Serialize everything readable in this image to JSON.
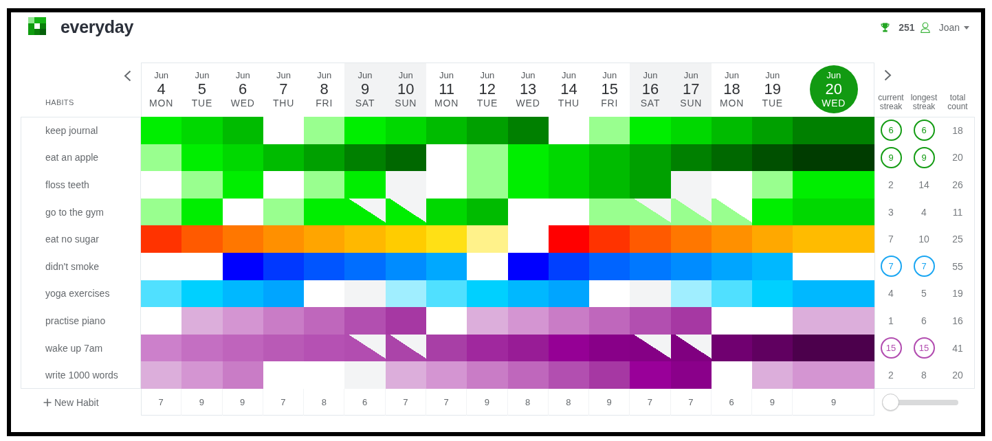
{
  "header": {
    "app_name": "everyday",
    "points": "251",
    "user_name": "Joan"
  },
  "table": {
    "habits_heading": "HABITS",
    "days": [
      {
        "month": "Jun",
        "day": "4",
        "weekday": "MON",
        "weekend": false,
        "selected": false
      },
      {
        "month": "Jun",
        "day": "5",
        "weekday": "TUE",
        "weekend": false,
        "selected": false
      },
      {
        "month": "Jun",
        "day": "6",
        "weekday": "WED",
        "weekend": false,
        "selected": false
      },
      {
        "month": "Jun",
        "day": "7",
        "weekday": "THU",
        "weekend": false,
        "selected": false
      },
      {
        "month": "Jun",
        "day": "8",
        "weekday": "FRI",
        "weekend": false,
        "selected": false
      },
      {
        "month": "Jun",
        "day": "9",
        "weekday": "SAT",
        "weekend": true,
        "selected": false
      },
      {
        "month": "Jun",
        "day": "10",
        "weekday": "SUN",
        "weekend": true,
        "selected": false
      },
      {
        "month": "Jun",
        "day": "11",
        "weekday": "MON",
        "weekend": false,
        "selected": false
      },
      {
        "month": "Jun",
        "day": "12",
        "weekday": "TUE",
        "weekend": false,
        "selected": false
      },
      {
        "month": "Jun",
        "day": "13",
        "weekday": "WED",
        "weekend": false,
        "selected": false
      },
      {
        "month": "Jun",
        "day": "14",
        "weekday": "THU",
        "weekend": false,
        "selected": false
      },
      {
        "month": "Jun",
        "day": "15",
        "weekday": "FRI",
        "weekend": false,
        "selected": false
      },
      {
        "month": "Jun",
        "day": "16",
        "weekday": "SAT",
        "weekend": true,
        "selected": false
      },
      {
        "month": "Jun",
        "day": "17",
        "weekday": "SUN",
        "weekend": true,
        "selected": false
      },
      {
        "month": "Jun",
        "day": "18",
        "weekday": "MON",
        "weekend": false,
        "selected": false
      },
      {
        "month": "Jun",
        "day": "19",
        "weekday": "TUE",
        "weekend": false,
        "selected": false
      },
      {
        "month": "Jun",
        "day": "20",
        "weekday": "WED",
        "weekend": false,
        "selected": true
      }
    ],
    "stat_headings": [
      "current streak",
      "longest streak",
      "total count"
    ],
    "habits": [
      {
        "name": "keep journal",
        "cells": [
          {
            "kind": "full",
            "color": "#00ee00"
          },
          {
            "kind": "full",
            "color": "#00d800"
          },
          {
            "kind": "full",
            "color": "#00bb00"
          },
          {
            "kind": "empty"
          },
          {
            "kind": "full",
            "color": "#99ff8f"
          },
          {
            "kind": "full",
            "color": "#00ee00"
          },
          {
            "kind": "full",
            "color": "#00d800"
          },
          {
            "kind": "full",
            "color": "#00bb00"
          },
          {
            "kind": "full",
            "color": "#00a000"
          },
          {
            "kind": "full",
            "color": "#008000"
          },
          {
            "kind": "empty"
          },
          {
            "kind": "full",
            "color": "#99ff8f"
          },
          {
            "kind": "full",
            "color": "#00ee00"
          },
          {
            "kind": "full",
            "color": "#00d800"
          },
          {
            "kind": "full",
            "color": "#00bb00"
          },
          {
            "kind": "full",
            "color": "#00a000"
          },
          {
            "kind": "full",
            "color": "#008000"
          }
        ],
        "current_streak": {
          "value": "6",
          "highlighted": true,
          "color": "#149c14"
        },
        "longest_streak": {
          "value": "6",
          "highlighted": true,
          "color": "#149c14"
        },
        "total": "18"
      },
      {
        "name": "eat an apple",
        "cells": [
          {
            "kind": "full",
            "color": "#99ff8f"
          },
          {
            "kind": "full",
            "color": "#00ee00"
          },
          {
            "kind": "full",
            "color": "#00d800"
          },
          {
            "kind": "full",
            "color": "#00bb00"
          },
          {
            "kind": "full",
            "color": "#00a000"
          },
          {
            "kind": "full",
            "color": "#008000"
          },
          {
            "kind": "full",
            "color": "#006800"
          },
          {
            "kind": "empty"
          },
          {
            "kind": "full",
            "color": "#99ff8f"
          },
          {
            "kind": "full",
            "color": "#00ee00"
          },
          {
            "kind": "full",
            "color": "#00d800"
          },
          {
            "kind": "full",
            "color": "#00bb00"
          },
          {
            "kind": "full",
            "color": "#00a000"
          },
          {
            "kind": "full",
            "color": "#008000"
          },
          {
            "kind": "full",
            "color": "#006800"
          },
          {
            "kind": "full",
            "color": "#005000"
          },
          {
            "kind": "full",
            "color": "#003c00"
          }
        ],
        "current_streak": {
          "value": "9",
          "highlighted": true,
          "color": "#149c14"
        },
        "longest_streak": {
          "value": "9",
          "highlighted": true,
          "color": "#149c14"
        },
        "total": "20"
      },
      {
        "name": "floss teeth",
        "cells": [
          {
            "kind": "empty"
          },
          {
            "kind": "full",
            "color": "#99ff8f"
          },
          {
            "kind": "full",
            "color": "#00ee00"
          },
          {
            "kind": "empty"
          },
          {
            "kind": "full",
            "color": "#99ff8f"
          },
          {
            "kind": "full",
            "color": "#00ee00"
          },
          {
            "kind": "empty"
          },
          {
            "kind": "empty"
          },
          {
            "kind": "full",
            "color": "#99ff8f"
          },
          {
            "kind": "full",
            "color": "#00ee00"
          },
          {
            "kind": "full",
            "color": "#00d800"
          },
          {
            "kind": "full",
            "color": "#00bb00"
          },
          {
            "kind": "full",
            "color": "#00a000"
          },
          {
            "kind": "empty"
          },
          {
            "kind": "empty"
          },
          {
            "kind": "full",
            "color": "#99ff8f"
          },
          {
            "kind": "full",
            "color": "#00ee00"
          }
        ],
        "current_streak": {
          "value": "2",
          "highlighted": false
        },
        "longest_streak": {
          "value": "14",
          "highlighted": false
        },
        "total": "26"
      },
      {
        "name": "go to the gym",
        "cells": [
          {
            "kind": "full",
            "color": "#99ff8f"
          },
          {
            "kind": "full",
            "color": "#00ee00"
          },
          {
            "kind": "empty"
          },
          {
            "kind": "full",
            "color": "#99ff8f"
          },
          {
            "kind": "full",
            "color": "#00ee00"
          },
          {
            "kind": "half",
            "color": "#00ee00"
          },
          {
            "kind": "half",
            "color": "#00ee00"
          },
          {
            "kind": "full",
            "color": "#00d800"
          },
          {
            "kind": "full",
            "color": "#00bb00"
          },
          {
            "kind": "empty"
          },
          {
            "kind": "empty"
          },
          {
            "kind": "full",
            "color": "#99ff8f"
          },
          {
            "kind": "half",
            "color": "#99ff8f"
          },
          {
            "kind": "half",
            "color": "#99ff8f"
          },
          {
            "kind": "half",
            "color": "#99ff8f"
          },
          {
            "kind": "full",
            "color": "#00ee00"
          },
          {
            "kind": "full",
            "color": "#00d800"
          }
        ],
        "current_streak": {
          "value": "3",
          "highlighted": false
        },
        "longest_streak": {
          "value": "4",
          "highlighted": false
        },
        "total": "11"
      },
      {
        "name": "eat no sugar",
        "cells": [
          {
            "kind": "full",
            "color": "#ff3300"
          },
          {
            "kind": "full",
            "color": "#ff5a00"
          },
          {
            "kind": "full",
            "color": "#ff7700"
          },
          {
            "kind": "full",
            "color": "#ff9000"
          },
          {
            "kind": "full",
            "color": "#ffa500"
          },
          {
            "kind": "full",
            "color": "#ffb800"
          },
          {
            "kind": "full",
            "color": "#ffcc00"
          },
          {
            "kind": "full",
            "color": "#ffe015"
          },
          {
            "kind": "full",
            "color": "#fff28a"
          },
          {
            "kind": "empty"
          },
          {
            "kind": "full",
            "color": "#ff0000"
          },
          {
            "kind": "full",
            "color": "#ff3300"
          },
          {
            "kind": "full",
            "color": "#ff5a00"
          },
          {
            "kind": "full",
            "color": "#ff7700"
          },
          {
            "kind": "full",
            "color": "#ff9000"
          },
          {
            "kind": "full",
            "color": "#ffa800"
          },
          {
            "kind": "full",
            "color": "#ffbb00"
          }
        ],
        "current_streak": {
          "value": "7",
          "highlighted": false
        },
        "longest_streak": {
          "value": "10",
          "highlighted": false
        },
        "total": "25"
      },
      {
        "name": "didn't smoke",
        "cells": [
          {
            "kind": "empty"
          },
          {
            "kind": "empty"
          },
          {
            "kind": "full",
            "color": "#0000ff"
          },
          {
            "kind": "full",
            "color": "#0038ff"
          },
          {
            "kind": "full",
            "color": "#0055ff"
          },
          {
            "kind": "full",
            "color": "#006eff"
          },
          {
            "kind": "full",
            "color": "#008cff"
          },
          {
            "kind": "full",
            "color": "#00a8ff"
          },
          {
            "kind": "empty"
          },
          {
            "kind": "full",
            "color": "#0000ff"
          },
          {
            "kind": "full",
            "color": "#0040ff"
          },
          {
            "kind": "full",
            "color": "#0064ff"
          },
          {
            "kind": "full",
            "color": "#0078ff"
          },
          {
            "kind": "full",
            "color": "#008cff"
          },
          {
            "kind": "full",
            "color": "#00a5ff"
          },
          {
            "kind": "full",
            "color": "#00b8ff"
          },
          {
            "kind": "empty"
          }
        ],
        "current_streak": {
          "value": "7",
          "highlighted": true,
          "color": "#1aa6f2"
        },
        "longest_streak": {
          "value": "7",
          "highlighted": true,
          "color": "#1aa6f2"
        },
        "total": "55"
      },
      {
        "name": "yoga exercises",
        "cells": [
          {
            "kind": "full",
            "color": "#50e0ff"
          },
          {
            "kind": "full",
            "color": "#00d0ff"
          },
          {
            "kind": "full",
            "color": "#00b8ff"
          },
          {
            "kind": "full",
            "color": "#00a5ff"
          },
          {
            "kind": "empty"
          },
          {
            "kind": "empty"
          },
          {
            "kind": "full",
            "color": "#a0eeff"
          },
          {
            "kind": "full",
            "color": "#50e0ff"
          },
          {
            "kind": "full",
            "color": "#00d0ff"
          },
          {
            "kind": "full",
            "color": "#00b8ff"
          },
          {
            "kind": "full",
            "color": "#00a5ff"
          },
          {
            "kind": "empty"
          },
          {
            "kind": "empty"
          },
          {
            "kind": "full",
            "color": "#a0eeff"
          },
          {
            "kind": "full",
            "color": "#50e0ff"
          },
          {
            "kind": "full",
            "color": "#00d0ff"
          },
          {
            "kind": "full",
            "color": "#00b8ff"
          }
        ],
        "current_streak": {
          "value": "4",
          "highlighted": false
        },
        "longest_streak": {
          "value": "5",
          "highlighted": false
        },
        "total": "19"
      },
      {
        "name": "practise piano",
        "cells": [
          {
            "kind": "empty"
          },
          {
            "kind": "full",
            "color": "#dcaedb"
          },
          {
            "kind": "full",
            "color": "#d495d2"
          },
          {
            "kind": "full",
            "color": "#c97cc6"
          },
          {
            "kind": "full",
            "color": "#bf67bc"
          },
          {
            "kind": "full",
            "color": "#b24fb0"
          },
          {
            "kind": "full",
            "color": "#a638a3"
          },
          {
            "kind": "empty"
          },
          {
            "kind": "full",
            "color": "#dcaedb"
          },
          {
            "kind": "full",
            "color": "#d495d2"
          },
          {
            "kind": "full",
            "color": "#c97cc6"
          },
          {
            "kind": "full",
            "color": "#bf67bc"
          },
          {
            "kind": "full",
            "color": "#b24fb0"
          },
          {
            "kind": "full",
            "color": "#a638a3"
          },
          {
            "kind": "empty"
          },
          {
            "kind": "empty"
          },
          {
            "kind": "full",
            "color": "#dcaedb"
          }
        ],
        "current_streak": {
          "value": "1",
          "highlighted": false
        },
        "longest_streak": {
          "value": "6",
          "highlighted": false
        },
        "total": "16"
      },
      {
        "name": "wake up 7am",
        "cells": [
          {
            "kind": "full",
            "color": "#cc80cb"
          },
          {
            "kind": "full",
            "color": "#c46fc2"
          },
          {
            "kind": "full",
            "color": "#bf64bc"
          },
          {
            "kind": "full",
            "color": "#b95ab6"
          },
          {
            "kind": "full",
            "color": "#b551b3"
          },
          {
            "kind": "half",
            "color": "#b24db0"
          },
          {
            "kind": "half",
            "color": "#ab44a9"
          },
          {
            "kind": "full",
            "color": "#a83fa6"
          },
          {
            "kind": "full",
            "color": "#a0289e"
          },
          {
            "kind": "full",
            "color": "#981c96"
          },
          {
            "kind": "full",
            "color": "#950095"
          },
          {
            "kind": "full",
            "color": "#880088"
          },
          {
            "kind": "half",
            "color": "#850085"
          },
          {
            "kind": "half",
            "color": "#800080"
          },
          {
            "kind": "full",
            "color": "#700070"
          },
          {
            "kind": "full",
            "color": "#600060"
          },
          {
            "kind": "full",
            "color": "#4c004c"
          }
        ],
        "current_streak": {
          "value": "15",
          "highlighted": true,
          "color": "#b24db0"
        },
        "longest_streak": {
          "value": "15",
          "highlighted": true,
          "color": "#b24db0"
        },
        "total": "41"
      },
      {
        "name": "write 1000 words",
        "cells": [
          {
            "kind": "full",
            "color": "#dcaedb"
          },
          {
            "kind": "full",
            "color": "#d495d2"
          },
          {
            "kind": "full",
            "color": "#c97cc6"
          },
          {
            "kind": "empty"
          },
          {
            "kind": "empty"
          },
          {
            "kind": "empty"
          },
          {
            "kind": "full",
            "color": "#dcaedb"
          },
          {
            "kind": "full",
            "color": "#d495d2"
          },
          {
            "kind": "full",
            "color": "#c97cc6"
          },
          {
            "kind": "full",
            "color": "#bf67bc"
          },
          {
            "kind": "full",
            "color": "#b24fb0"
          },
          {
            "kind": "full",
            "color": "#a638a3"
          },
          {
            "kind": "full",
            "color": "#990099"
          },
          {
            "kind": "full",
            "color": "#8a008a"
          },
          {
            "kind": "empty"
          },
          {
            "kind": "full",
            "color": "#dcaedb"
          },
          {
            "kind": "full",
            "color": "#d495d2"
          }
        ],
        "current_streak": {
          "value": "2",
          "highlighted": false
        },
        "longest_streak": {
          "value": "8",
          "highlighted": false
        },
        "total": "20"
      }
    ],
    "day_totals": [
      "7",
      "9",
      "9",
      "7",
      "8",
      "6",
      "7",
      "7",
      "9",
      "8",
      "8",
      "9",
      "7",
      "7",
      "6",
      "9",
      "9"
    ],
    "new_habit_label": "New Habit",
    "zoom_slider": {
      "level": 0
    }
  }
}
